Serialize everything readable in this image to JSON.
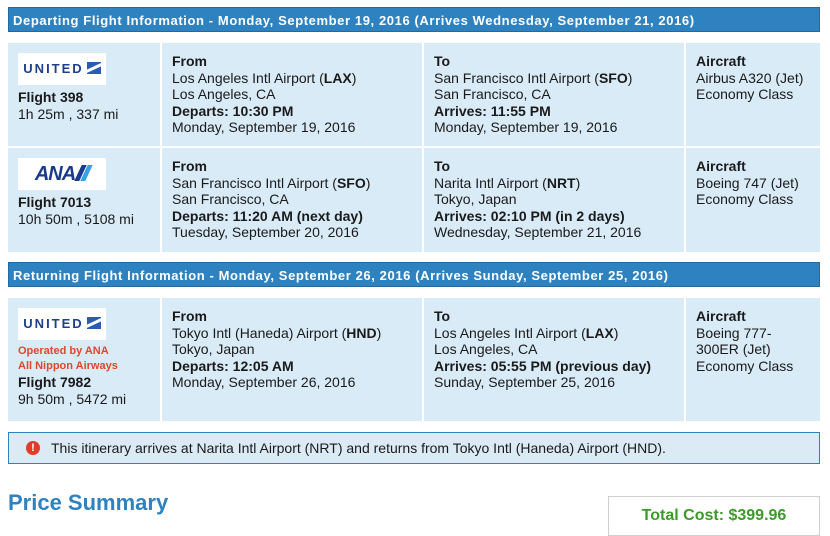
{
  "departing": {
    "header": "Departing Flight Information - Monday, September 19, 2016 (Arrives Wednesday, September 21, 2016)",
    "flights": [
      {
        "airline_logo": "UNITED",
        "flight": "Flight 398",
        "duration": "1h 25m , 337 mi",
        "from_label": "From",
        "from_airport": "Los Angeles Intl Airport (",
        "from_code": "LAX",
        "from_airport_end": ")",
        "from_city": "Los Angeles, CA",
        "departs": "Departs: 10:30 PM",
        "depart_date": "Monday, September 19, 2016",
        "to_label": "To",
        "to_airport": "San Francisco Intl Airport (",
        "to_code": "SFO",
        "to_airport_end": ")",
        "to_city": "San Francisco, CA",
        "arrives": "Arrives: 11:55 PM",
        "arrive_date": "Monday, September 19, 2016",
        "aircraft_label": "Aircraft",
        "aircraft_1": "Airbus A320 (Jet)",
        "cabin": "Economy Class"
      },
      {
        "airline_logo": "ANA",
        "flight": "Flight 7013",
        "duration": "10h 50m , 5108 mi",
        "from_label": "From",
        "from_airport": "San Francisco Intl Airport (",
        "from_code": "SFO",
        "from_airport_end": ")",
        "from_city": "San Francisco, CA",
        "departs": "Departs: 11:20 AM (next day)",
        "depart_date": "Tuesday, September 20, 2016",
        "to_label": "To",
        "to_airport": "Narita Intl Airport (",
        "to_code": "NRT",
        "to_airport_end": ")",
        "to_city": "Tokyo, Japan",
        "arrives": "Arrives: 02:10 PM (in 2 days)",
        "arrive_date": "Wednesday, September 21, 2016",
        "aircraft_label": "Aircraft",
        "aircraft_1": "Boeing 747 (Jet)",
        "cabin": "Economy Class"
      }
    ]
  },
  "returning": {
    "header": "Returning Flight Information - Monday, September 26, 2016 (Arrives Sunday, September 25, 2016)",
    "flights": [
      {
        "airline_logo": "UNITED",
        "operated_by_1": "Operated by ANA",
        "operated_by_2": "All Nippon Airways",
        "flight": "Flight 7982",
        "duration": "9h 50m , 5472 mi",
        "from_label": "From",
        "from_airport": "Tokyo Intl (Haneda) Airport (",
        "from_code": "HND",
        "from_airport_end": ")",
        "from_city": "Tokyo, Japan",
        "departs": "Departs: 12:05 AM",
        "depart_date": "Monday, September 26, 2016",
        "to_label": "To",
        "to_airport": "Los Angeles Intl Airport (",
        "to_code": "LAX",
        "to_airport_end": ")",
        "to_city": "Los Angeles, CA",
        "arrives": "Arrives: 05:55 PM (previous day)",
        "arrive_date": "Sunday, September 25, 2016",
        "aircraft_label": "Aircraft",
        "aircraft_1": "Boeing 777-",
        "aircraft_2": "300ER (Jet)",
        "cabin": "Economy Class"
      }
    ]
  },
  "notice": {
    "icon": "alert-icon",
    "icon_glyph": "!",
    "text": "This itinerary arrives at Narita Intl Airport (NRT) and returns from Tokyo Intl (Haneda) Airport (HND)."
  },
  "price_summary": {
    "title": "Price Summary",
    "total": "Total Cost: $399.96"
  },
  "colors": {
    "header_bg": "#2f82c0",
    "row_bg": "#d9ebf7",
    "operated_by": "#e0462a",
    "total": "#3d9a2a"
  }
}
